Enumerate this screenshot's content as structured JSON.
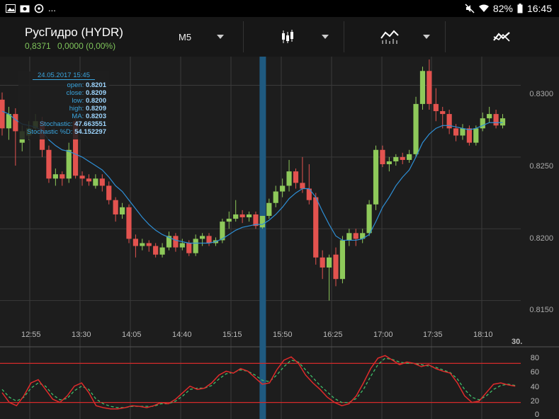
{
  "status_bar": {
    "left_icons": [
      "image-icon",
      "photo-icon",
      "sync-icon"
    ],
    "ellipsis": "...",
    "battery": "82%",
    "time": "16:45"
  },
  "header": {
    "title": "РусГидро (HYDR)",
    "price": "0,8371",
    "change": "0,0000 (0,00%)",
    "timeframe": "M5",
    "chart_type_icon": "candlestick-icon",
    "indicator_icon": "indicators-icon",
    "trend_icon": "trend-icon"
  },
  "colors": {
    "up": "#8ec95a",
    "down": "#e3534f",
    "ma": "#2e8fd6",
    "stoch_k": "#e02b2b",
    "stoch_d": "#3fbf6a",
    "highlight": "#1f5a80",
    "quote": "#7ec45a"
  },
  "info_box": {
    "date": "24.05.2017 15:45",
    "rows": [
      {
        "label": "open:",
        "value": "0.8201"
      },
      {
        "label": "close:",
        "value": "0.8209"
      },
      {
        "label": "low:",
        "value": "0.8200"
      },
      {
        "label": "high:",
        "value": "0.8209"
      },
      {
        "label": "MA:",
        "value": "0.8203"
      },
      {
        "label": "Stochastic:",
        "value": "47.663551"
      },
      {
        "label": "Stochastic %D:",
        "value": "54.152297"
      }
    ]
  },
  "chart_data": {
    "type": "candlestick",
    "price_ticks": [
      "0.8300",
      "0.8250",
      "0.8200",
      "0.8150"
    ],
    "time_ticks": [
      "12:55",
      "13:30",
      "14:05",
      "14:40",
      "15:15",
      "15:50",
      "16:25",
      "17:00",
      "17:35",
      "18:10"
    ],
    "date_marker": "30.",
    "ylim": [
      0.8135,
      0.832
    ],
    "highlight_time": "15:45",
    "candles": [
      [
        0.829,
        0.827,
        0.8295,
        0.8265
      ],
      [
        0.827,
        0.828,
        0.8285,
        0.8262
      ],
      [
        0.828,
        0.8268,
        0.8284,
        0.8244
      ],
      [
        0.826,
        0.8268,
        0.8272,
        0.8254
      ],
      [
        0.8265,
        0.827,
        0.8275,
        0.8262
      ],
      [
        0.827,
        0.8275,
        0.828,
        0.8266
      ],
      [
        0.8275,
        0.8255,
        0.8278,
        0.825
      ],
      [
        0.8255,
        0.8235,
        0.8258,
        0.8232
      ],
      [
        0.8235,
        0.8238,
        0.8242,
        0.823
      ],
      [
        0.8238,
        0.8235,
        0.824,
        0.823
      ],
      [
        0.8235,
        0.8255,
        0.826,
        0.8232
      ],
      [
        0.8275,
        0.8237,
        0.8278,
        0.8235
      ],
      [
        0.8237,
        0.8235,
        0.824,
        0.823
      ],
      [
        0.8235,
        0.8233,
        0.8238,
        0.823
      ],
      [
        0.823,
        0.8235,
        0.8238,
        0.8228
      ],
      [
        0.8235,
        0.823,
        0.8238,
        0.8226
      ],
      [
        0.823,
        0.822,
        0.8233,
        0.8217
      ],
      [
        0.822,
        0.821,
        0.8222,
        0.8205
      ],
      [
        0.821,
        0.8215,
        0.8218,
        0.8207
      ],
      [
        0.8215,
        0.8193,
        0.8217,
        0.819
      ],
      [
        0.8193,
        0.8188,
        0.8196,
        0.818
      ],
      [
        0.8188,
        0.819,
        0.8193,
        0.8185
      ],
      [
        0.819,
        0.8188,
        0.8192,
        0.8184
      ],
      [
        0.8188,
        0.8182,
        0.819,
        0.818
      ],
      [
        0.8182,
        0.8187,
        0.819,
        0.818
      ],
      [
        0.8187,
        0.8195,
        0.8198,
        0.8185
      ],
      [
        0.8195,
        0.8187,
        0.8197,
        0.8184
      ],
      [
        0.8187,
        0.819,
        0.8193,
        0.8185
      ],
      [
        0.819,
        0.8183,
        0.8192,
        0.8181
      ],
      [
        0.8183,
        0.8193,
        0.8196,
        0.8181
      ],
      [
        0.8193,
        0.8195,
        0.8197,
        0.8188
      ],
      [
        0.8195,
        0.819,
        0.8197,
        0.8188
      ],
      [
        0.819,
        0.8192,
        0.8194,
        0.8188
      ],
      [
        0.8192,
        0.8205,
        0.8207,
        0.819
      ],
      [
        0.8205,
        0.8207,
        0.8212,
        0.82
      ],
      [
        0.8207,
        0.821,
        0.822,
        0.8205
      ],
      [
        0.821,
        0.8208,
        0.8213,
        0.8204
      ],
      [
        0.8208,
        0.821,
        0.8212,
        0.8205
      ],
      [
        0.821,
        0.8202,
        0.8212,
        0.82
      ],
      [
        0.8201,
        0.8209,
        0.8209,
        0.82
      ],
      [
        0.8209,
        0.8218,
        0.8221,
        0.8207
      ],
      [
        0.8218,
        0.8226,
        0.823,
        0.8215
      ],
      [
        0.8226,
        0.823,
        0.8235,
        0.8222
      ],
      [
        0.823,
        0.824,
        0.8248,
        0.8226
      ],
      [
        0.824,
        0.8232,
        0.8242,
        0.8228
      ],
      [
        0.8232,
        0.8228,
        0.825,
        0.8225
      ],
      [
        0.8228,
        0.822,
        0.8245,
        0.8217
      ],
      [
        0.8222,
        0.818,
        0.8225,
        0.8175
      ],
      [
        0.818,
        0.8173,
        0.8185,
        0.8165
      ],
      [
        0.8173,
        0.818,
        0.8182,
        0.815
      ],
      [
        0.8182,
        0.8165,
        0.8187,
        0.816
      ],
      [
        0.8165,
        0.8192,
        0.8195,
        0.8162
      ],
      [
        0.8192,
        0.8197,
        0.82,
        0.8188
      ],
      [
        0.8197,
        0.8193,
        0.82,
        0.8188
      ],
      [
        0.8193,
        0.8197,
        0.82,
        0.819
      ],
      [
        0.8197,
        0.8217,
        0.822,
        0.8195
      ],
      [
        0.8217,
        0.8255,
        0.8258,
        0.8213
      ],
      [
        0.8255,
        0.8245,
        0.8258,
        0.8243
      ],
      [
        0.8245,
        0.8247,
        0.825,
        0.824
      ],
      [
        0.8247,
        0.825,
        0.8252,
        0.8244
      ],
      [
        0.825,
        0.8248,
        0.8253,
        0.8245
      ],
      [
        0.8248,
        0.8252,
        0.8255,
        0.8246
      ],
      [
        0.8252,
        0.8287,
        0.8292,
        0.825
      ],
      [
        0.8287,
        0.831,
        0.8313,
        0.8283
      ],
      [
        0.831,
        0.8287,
        0.8318,
        0.8283
      ],
      [
        0.8287,
        0.8282,
        0.8298,
        0.8275
      ],
      [
        0.8282,
        0.828,
        0.8285,
        0.827
      ],
      [
        0.828,
        0.827,
        0.8283,
        0.8266
      ],
      [
        0.827,
        0.8265,
        0.8273,
        0.8261
      ],
      [
        0.8265,
        0.827,
        0.8273,
        0.8262
      ],
      [
        0.827,
        0.826,
        0.8272,
        0.8258
      ],
      [
        0.826,
        0.827,
        0.8272,
        0.8258
      ],
      [
        0.827,
        0.8277,
        0.8281,
        0.8268
      ],
      [
        0.8277,
        0.828,
        0.8285,
        0.8274
      ],
      [
        0.828,
        0.8272,
        0.8283,
        0.827
      ],
      [
        0.8272,
        0.8277,
        0.828,
        0.827
      ]
    ],
    "ma": [
      0.8282,
      0.828,
      0.8276,
      0.8273,
      0.8272,
      0.8271,
      0.8268,
      0.8262,
      0.8258,
      0.8255,
      0.8254,
      0.8252,
      0.825,
      0.8247,
      0.8244,
      0.8241,
      0.8236,
      0.823,
      0.8226,
      0.822,
      0.8214,
      0.8208,
      0.8203,
      0.8199,
      0.8196,
      0.8194,
      0.8192,
      0.8191,
      0.819,
      0.819,
      0.819,
      0.819,
      0.8191,
      0.8193,
      0.8196,
      0.8199,
      0.8201,
      0.8202,
      0.8203,
      0.8203,
      0.8206,
      0.821,
      0.8215,
      0.8221,
      0.8225,
      0.8228,
      0.8228,
      0.8222,
      0.8212,
      0.8203,
      0.8195,
      0.8192,
      0.8192,
      0.8192,
      0.8193,
      0.8196,
      0.8205,
      0.8215,
      0.8222,
      0.823,
      0.8236,
      0.8241,
      0.825,
      0.826,
      0.8266,
      0.827,
      0.8272,
      0.8272,
      0.8271,
      0.827,
      0.8269,
      0.827,
      0.8272,
      0.8274,
      0.8274,
      0.8274
    ],
    "osc_ticks": [
      "80",
      "60",
      "40",
      "20",
      "0"
    ],
    "osc_levels": [
      80,
      20
    ],
    "stoch_k": [
      35,
      20,
      15,
      30,
      50,
      55,
      40,
      25,
      20,
      30,
      45,
      50,
      35,
      15,
      12,
      10,
      10,
      12,
      15,
      14,
      12,
      15,
      20,
      18,
      25,
      35,
      45,
      40,
      42,
      50,
      62,
      68,
      65,
      72,
      68,
      58,
      48,
      50,
      70,
      85,
      90,
      80,
      62,
      50,
      40,
      28,
      20,
      15,
      18,
      30,
      50,
      72,
      88,
      92,
      85,
      78,
      82,
      80,
      75,
      78,
      72,
      68,
      65,
      50,
      30,
      20,
      22,
      35,
      48,
      50,
      47,
      45
    ],
    "stoch_d": [
      40,
      28,
      22,
      28,
      42,
      50,
      45,
      32,
      24,
      26,
      38,
      45,
      40,
      25,
      18,
      14,
      12,
      12,
      14,
      14,
      14,
      14,
      18,
      18,
      22,
      30,
      40,
      42,
      42,
      46,
      56,
      64,
      66,
      70,
      68,
      62,
      54,
      52,
      62,
      75,
      85,
      82,
      70,
      58,
      46,
      36,
      26,
      20,
      20,
      26,
      40,
      60,
      78,
      88,
      86,
      82,
      80,
      80,
      78,
      76,
      74,
      70,
      66,
      56,
      40,
      28,
      24,
      30,
      40,
      46,
      48,
      46
    ]
  }
}
